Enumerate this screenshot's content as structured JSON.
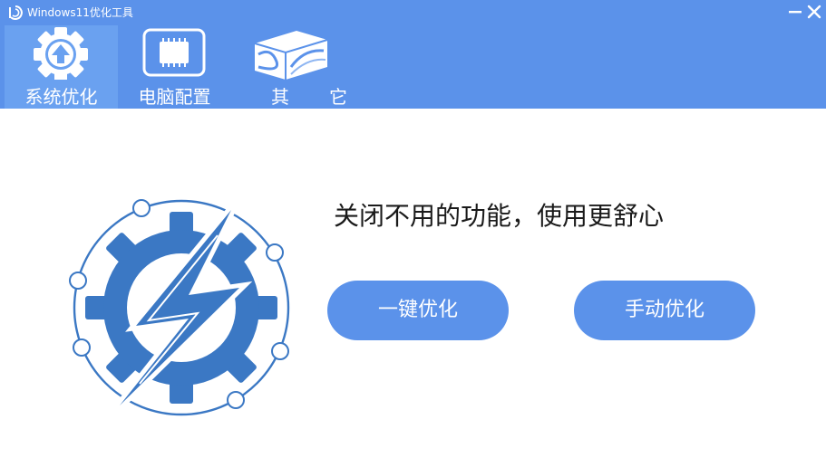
{
  "window": {
    "title": "Windows11优化工具",
    "icons": {
      "logo": "app-logo-icon",
      "minimize": "minimize-icon",
      "close": "close-icon"
    }
  },
  "nav": {
    "tabs": [
      {
        "label": "系统优化",
        "icon": "gear-upload-icon",
        "active": true
      },
      {
        "label": "电脑配置",
        "icon": "chip-icon",
        "active": false
      },
      {
        "label": "其它",
        "icon": "wave-box-icon",
        "active": false
      }
    ]
  },
  "main": {
    "headline": "关闭不用的功能，使用更舒心",
    "illustration": "gear-lightning-icon",
    "buttons": {
      "one_click": "一键优化",
      "manual": "手动优化"
    }
  },
  "colors": {
    "header_bg": "#5b92ea",
    "active_tab_bg": "#6aa1f0",
    "button_bg": "#5b92ea",
    "gear_blue": "#3b78c4",
    "text_dark": "#1a1a1a"
  }
}
